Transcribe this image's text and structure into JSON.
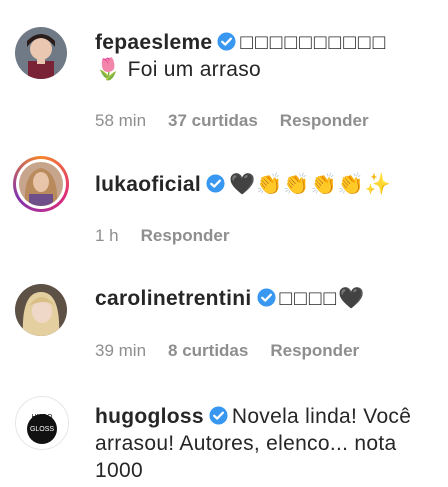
{
  "comments": [
    {
      "username": "fepaesleme",
      "verified": true,
      "line1": "□□□□□□□□□□",
      "line2": "🌷 Foi um arraso",
      "time": "58 min",
      "likes": "37 curtidas",
      "reply": "Responder"
    },
    {
      "username": "lukaoficial",
      "verified": true,
      "line1": "🖤👏👏👏👏✨",
      "time": "1 h",
      "reply": "Responder"
    },
    {
      "username": "carolinetrentini",
      "verified": true,
      "line1": "□□□□🖤",
      "time": "39 min",
      "likes": "8 curtidas",
      "reply": "Responder"
    },
    {
      "username": "hugogloss",
      "verified": true,
      "line1": "Novela linda! Você",
      "line2": "arrasou! Autores, elenco... nota",
      "line3": "1000",
      "avatar_text_top": "HUGO",
      "avatar_text_bottom": "GLOSS"
    }
  ],
  "colors": {
    "verified_blue": "#3897f0",
    "meta_gray": "#8e8e8e",
    "text": "#262626"
  }
}
